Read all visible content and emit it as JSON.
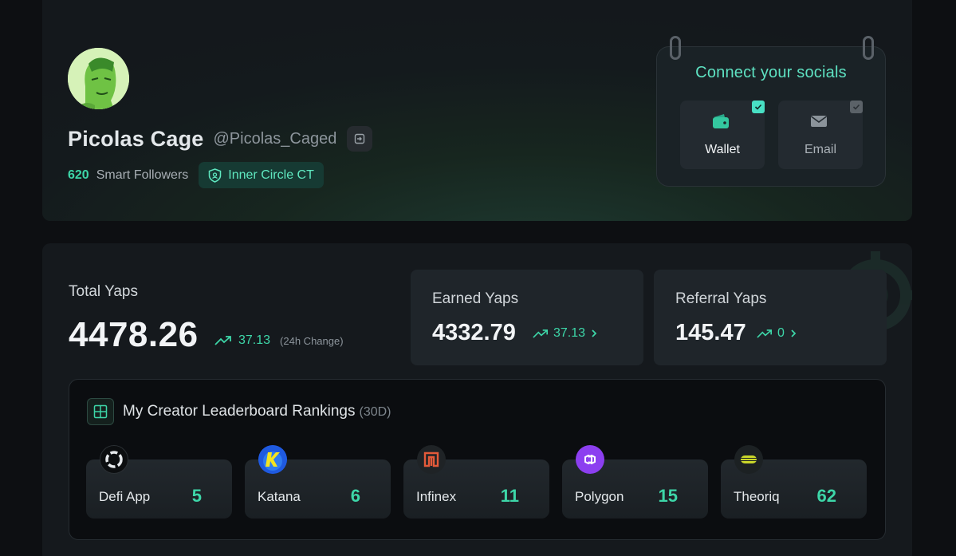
{
  "profile": {
    "display_name": "Picolas Cage",
    "handle": "@Picolas_Caged",
    "followers_count": "620",
    "followers_label": "Smart Followers",
    "badge_label": "Inner Circle CT"
  },
  "socials": {
    "title": "Connect your socials",
    "tiles": [
      {
        "label": "Wallet",
        "icon": "wallet-icon",
        "connected": true
      },
      {
        "label": "Email",
        "icon": "mail-icon",
        "connected": false
      }
    ]
  },
  "stats": {
    "total_label": "Total Yaps",
    "total_value": "4478.26",
    "total_change": "37.13",
    "total_change_note": "(24h Change)",
    "earned_label": "Earned Yaps",
    "earned_value": "4332.79",
    "earned_change": "37.13",
    "referral_label": "Referral Yaps",
    "referral_value": "145.47",
    "referral_change": "0"
  },
  "leaderboard": {
    "title": "My Creator Leaderboard Rankings",
    "period": "(30D)",
    "items": [
      {
        "name": "Defi App",
        "rank": "5"
      },
      {
        "name": "Katana",
        "rank": "6"
      },
      {
        "name": "Infinex",
        "rank": "11"
      },
      {
        "name": "Polygon",
        "rank": "15"
      },
      {
        "name": "Theoriq",
        "rank": "62"
      }
    ]
  },
  "colors": {
    "accent": "#3dd6a8",
    "background": "#0d0f12",
    "card": "#15191d"
  }
}
